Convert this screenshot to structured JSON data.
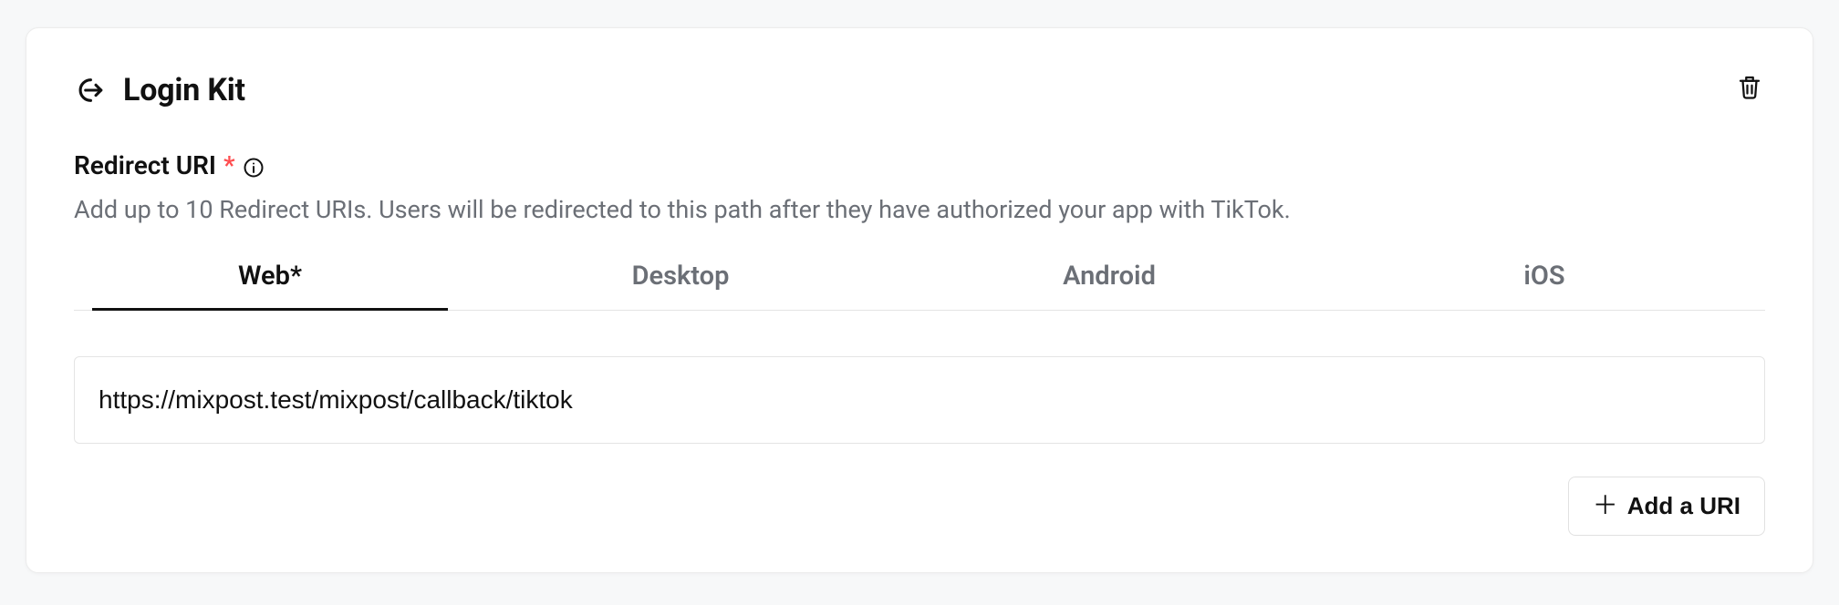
{
  "card": {
    "title": "Login Kit"
  },
  "field": {
    "label": "Redirect URI",
    "required_mark": "*",
    "helper": "Add up to 10 Redirect URIs. Users will be redirected to this path after they have authorized your app with TikTok."
  },
  "tabs": [
    {
      "label": "Web*",
      "active": true
    },
    {
      "label": "Desktop",
      "active": false
    },
    {
      "label": "Android",
      "active": false
    },
    {
      "label": "iOS",
      "active": false
    }
  ],
  "uri": {
    "value": "https://mixpost.test/mixpost/callback/tiktok"
  },
  "actions": {
    "add_uri": "Add a URI"
  }
}
